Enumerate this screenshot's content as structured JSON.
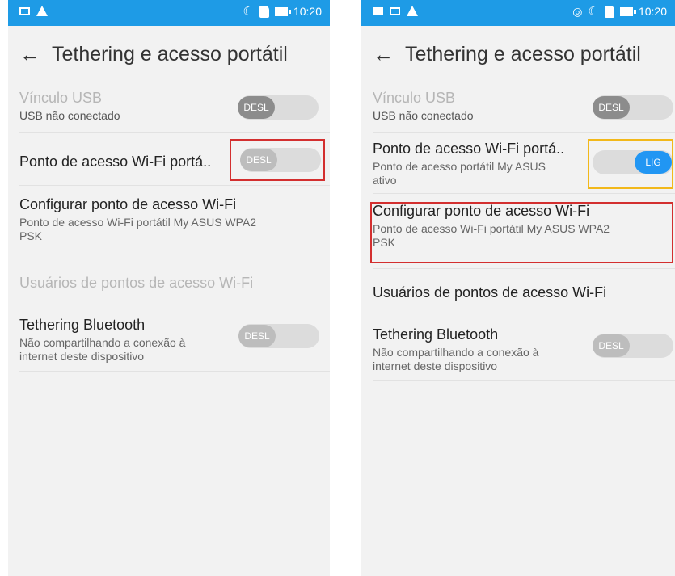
{
  "left": {
    "status": {
      "time": "10:20"
    },
    "title": "Tethering e acesso portátil",
    "items": [
      {
        "title": "Vínculo USB",
        "subtitle": "USB não conectado",
        "toggle": "DESL"
      },
      {
        "title": "Ponto de acesso Wi-Fi portá..",
        "toggle": "DESL"
      },
      {
        "title": "Configurar ponto de acesso Wi-Fi",
        "subtitle_line1": "Ponto de acesso Wi-Fi portátil My ASUS WPA2",
        "subtitle_line2": "PSK"
      },
      {
        "title": "Usuários de pontos de acesso Wi-Fi"
      },
      {
        "title": "Tethering Bluetooth",
        "subtitle_line1": "Não compartilhando a conexão à",
        "subtitle_line2": "internet deste dispositivo",
        "toggle": "DESL"
      }
    ]
  },
  "right": {
    "status": {
      "time": "10:20"
    },
    "title": "Tethering e acesso portátil",
    "items": [
      {
        "title": "Vínculo USB",
        "subtitle": "USB não conectado",
        "toggle": "DESL"
      },
      {
        "title": "Ponto de acesso Wi-Fi portá..",
        "subtitle_line1": "Ponto de acesso portátil My ASUS",
        "subtitle_line2": "ativo",
        "toggle": "LIG"
      },
      {
        "title": "Configurar ponto de acesso Wi-Fi",
        "subtitle_line1": "Ponto de acesso Wi-Fi portátil My ASUS WPA2",
        "subtitle_line2": "PSK"
      },
      {
        "title": "Usuários de pontos de acesso Wi-Fi"
      },
      {
        "title": "Tethering Bluetooth",
        "subtitle_line1": "Não compartilhando a conexão à",
        "subtitle_line2": "internet deste dispositivo",
        "toggle": "DESL"
      }
    ]
  },
  "colors": {
    "statusbar": "#1e9be6",
    "toggle_on": "#2196f3",
    "highlight_red": "#d32f2f",
    "highlight_yellow": "#f2b81a"
  }
}
